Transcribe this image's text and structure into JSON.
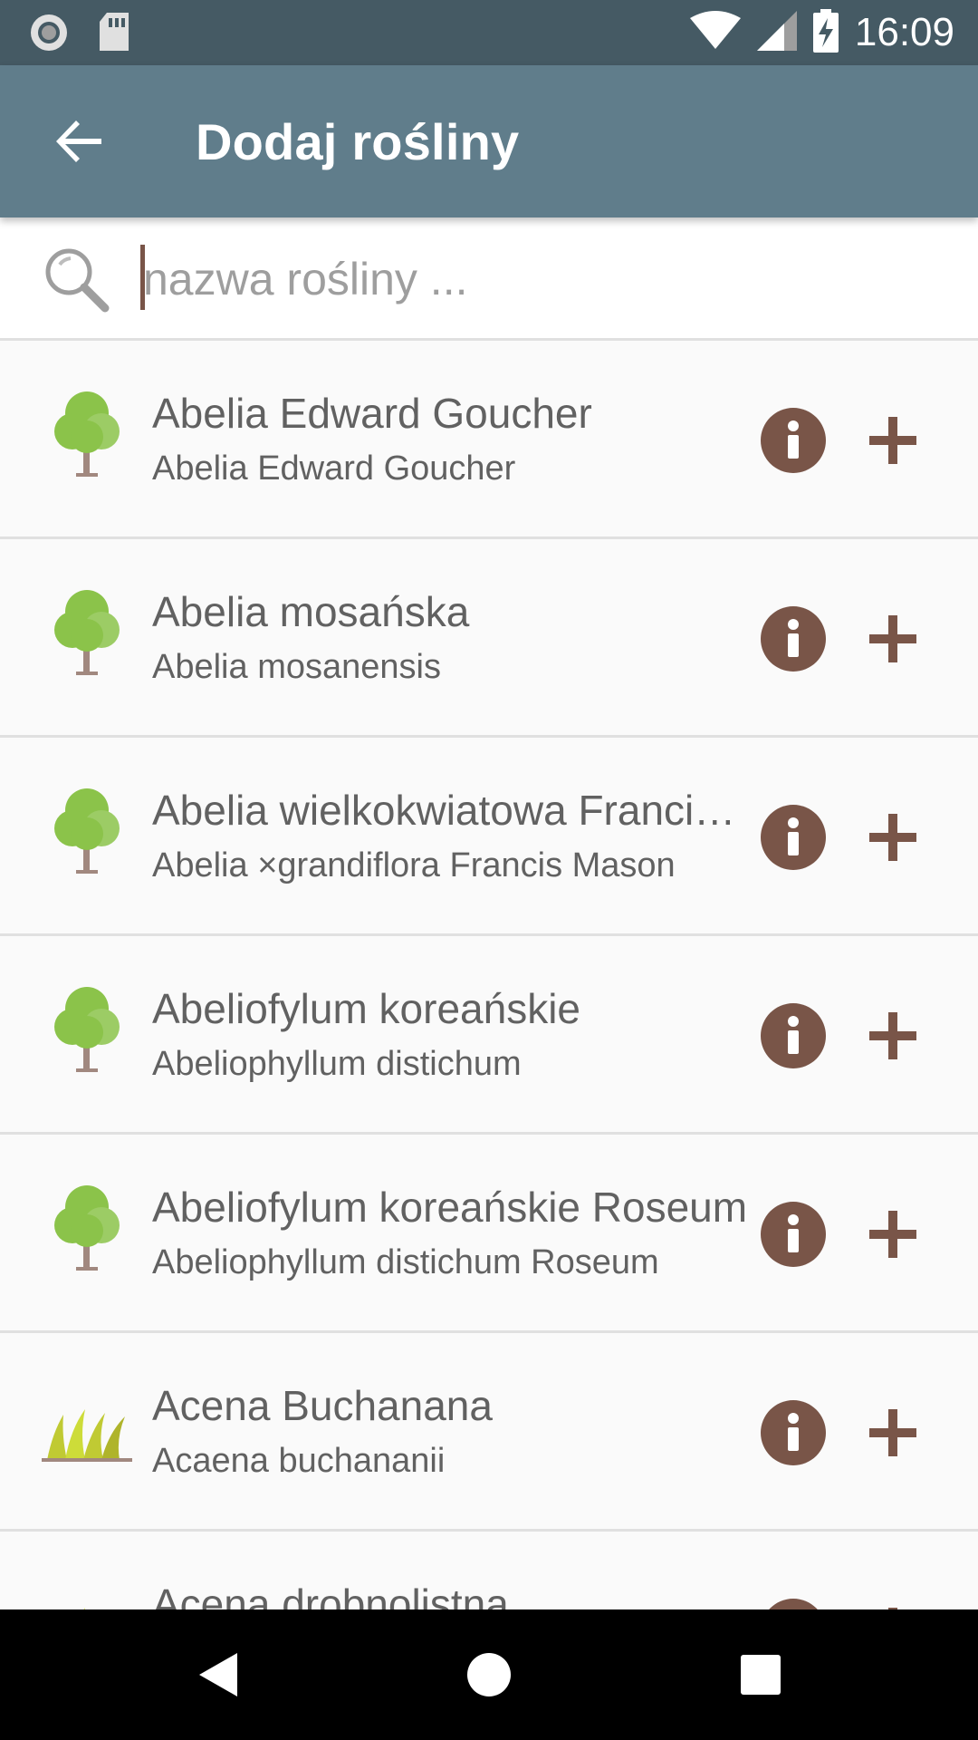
{
  "status_bar": {
    "time": "16:09",
    "left_icons": [
      "record-icon",
      "sd-card-icon"
    ],
    "right_icons": [
      "wifi-icon",
      "signal-icon",
      "battery-charging-icon"
    ]
  },
  "app_bar": {
    "title": "Dodaj rośliny",
    "back_icon": "arrow-back-icon",
    "color": "#607d8b"
  },
  "search": {
    "placeholder": "nazwa rośliny ...",
    "value": ""
  },
  "colors": {
    "accent": "#795548",
    "status_bar": "#455a64",
    "tree_green": "#8bc34a",
    "grass_yellow": "#c0ca33"
  },
  "plants": [
    {
      "name": "Abelia Edward Goucher",
      "latin": "Abelia Edward Goucher",
      "icon": "tree-icon"
    },
    {
      "name": "Abelia mosańska",
      "latin": "Abelia mosanensis",
      "icon": "tree-icon"
    },
    {
      "name": "Abelia wielkokwiatowa Francis Mason",
      "latin": "Abelia ×grandiflora Francis Mason",
      "icon": "tree-icon"
    },
    {
      "name": "Abeliofylum koreańskie",
      "latin": "Abeliophyllum distichum",
      "icon": "tree-icon"
    },
    {
      "name": "Abeliofylum koreańskie Roseum",
      "latin": "Abeliophyllum distichum Roseum",
      "icon": "tree-icon"
    },
    {
      "name": "Acena Buchanana",
      "latin": "Acaena buchananii",
      "icon": "grass-icon"
    },
    {
      "name": "Acena drobnolistna",
      "latin": "",
      "icon": "grass-icon"
    }
  ],
  "nav_bar": {
    "buttons": [
      "back-triangle-icon",
      "home-circle-icon",
      "recents-square-icon"
    ]
  }
}
